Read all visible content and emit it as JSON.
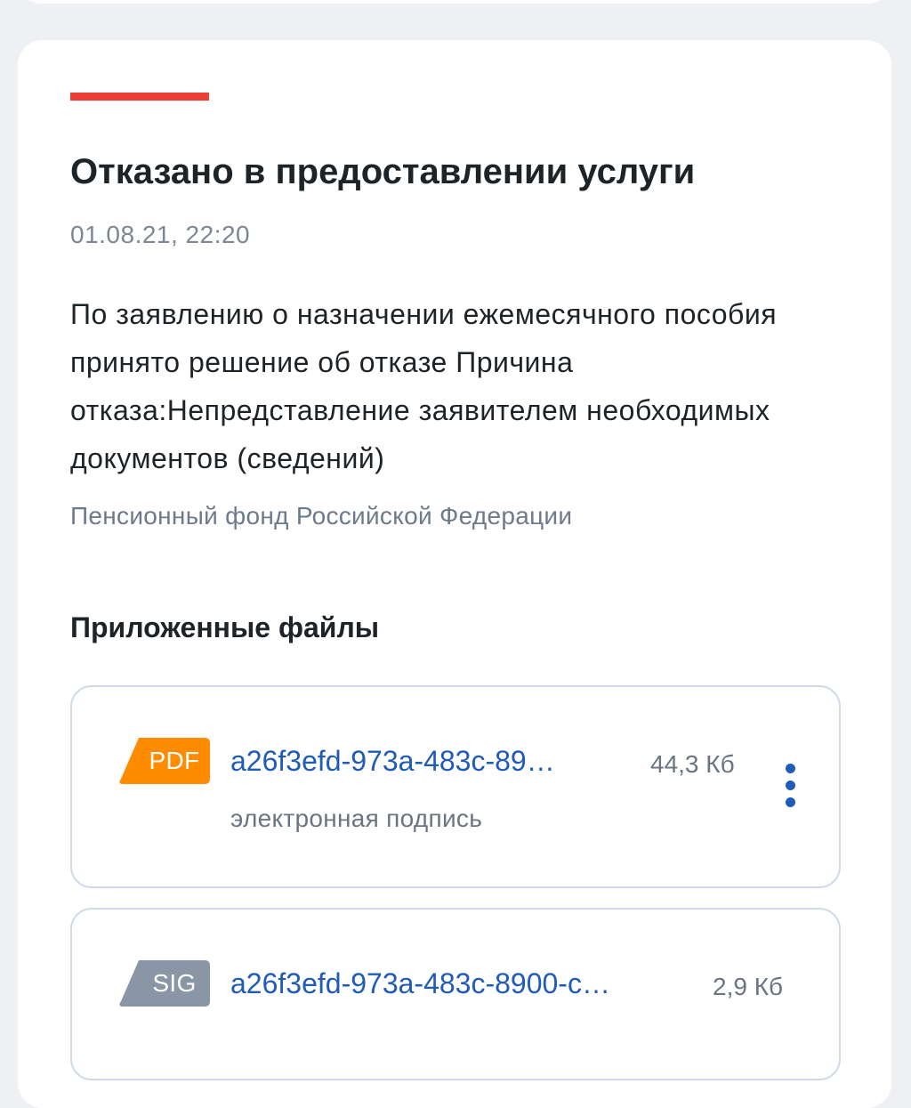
{
  "notification": {
    "title": "Отказано в предоставлении услуги",
    "datetime": "01.08.21, 22:20",
    "message": "По заявлению о назначении ежемесячного пособия принято решение об отказе Причина отказа:Непредставление заявителем необходимых документов (сведений)",
    "source": "Пенсионный фонд Российской Федерации",
    "accent_color": "#ee3f36"
  },
  "attachments": {
    "title": "Приложенные файлы",
    "files": [
      {
        "type": "PDF",
        "type_color": "#ff8c00",
        "icon": "pdf-file-icon",
        "name": "a26f3efd-973a-483c-89…",
        "size": "44,3 Кб",
        "subtitle": "электронная подпись",
        "menu_icon": "kebab-menu-icon"
      },
      {
        "type": "SIG",
        "type_color": "#8a96a6",
        "icon": "sig-file-icon",
        "name": "a26f3efd-973a-483c-8900-c…",
        "size": "2,9 Кб"
      }
    ]
  }
}
